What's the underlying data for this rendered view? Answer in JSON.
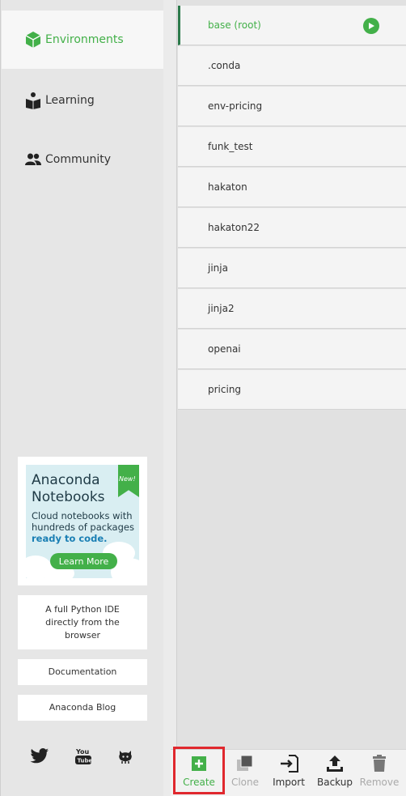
{
  "nav": {
    "environments": "Environments",
    "learning": "Learning",
    "community": "Community"
  },
  "promo": {
    "title_line1": "Anaconda",
    "title_line2": "Notebooks",
    "badge": "New!",
    "text_part1": "Cloud notebooks with hundreds of packages",
    "text_highlight": "ready to code.",
    "button": "Learn More"
  },
  "side_cards": {
    "ide": "A full Python IDE directly from the browser",
    "documentation": "Documentation",
    "blog": "Anaconda Blog"
  },
  "environments": [
    {
      "name": "base (root)",
      "active": true
    },
    {
      "name": ".conda"
    },
    {
      "name": "env-pricing"
    },
    {
      "name": "funk_test"
    },
    {
      "name": "hakaton"
    },
    {
      "name": "hakaton22"
    },
    {
      "name": "jinja"
    },
    {
      "name": "jinja2"
    },
    {
      "name": "openai"
    },
    {
      "name": "pricing"
    }
  ],
  "toolbar": {
    "create": "Create",
    "clone": "Clone",
    "import": "Import",
    "backup": "Backup",
    "remove": "Remove"
  },
  "colors": {
    "accent": "#43b049",
    "highlight_box": "#e0282e"
  },
  "icons": {
    "environments": "cube-icon",
    "learning": "book-reader-icon",
    "community": "people-icon",
    "twitter": "twitter-icon",
    "youtube": "youtube-icon",
    "github": "github-icon"
  }
}
